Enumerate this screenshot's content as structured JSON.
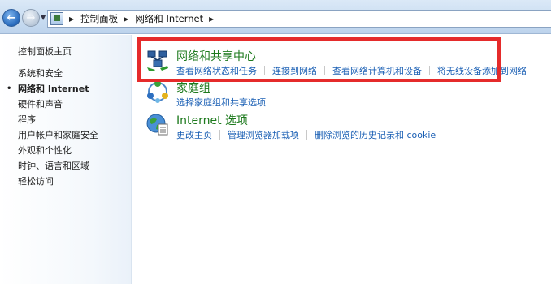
{
  "address_bar": {
    "crumbs": [
      "控制面板",
      "网络和 Internet"
    ]
  },
  "sidebar": {
    "home_label": "控制面板主页",
    "items": [
      {
        "label": "系统和安全"
      },
      {
        "label": "网络和 Internet",
        "active": true
      },
      {
        "label": "硬件和声音"
      },
      {
        "label": "程序"
      },
      {
        "label": "用户帐户和家庭安全"
      },
      {
        "label": "外观和个性化"
      },
      {
        "label": "时钟、语言和区域"
      },
      {
        "label": "轻松访问"
      }
    ],
    "active_bullet": "•"
  },
  "categories": [
    {
      "title": "网络和共享中心",
      "icon": "network-sharing-center-icon",
      "links": [
        "查看网络状态和任务",
        "连接到网络",
        "查看网络计算机和设备",
        "将无线设备添加到网络"
      ]
    },
    {
      "title": "家庭组",
      "icon": "homegroup-icon",
      "links": [
        "选择家庭组和共享选项"
      ]
    },
    {
      "title": "Internet 选项",
      "icon": "internet-options-icon",
      "links": [
        "更改主页",
        "管理浏览器加载项",
        "删除浏览的历史记录和 cookie"
      ]
    }
  ],
  "colors": {
    "category_title": "#1e7a1e",
    "link": "#1a5fb4",
    "highlight_border": "#e52b2b"
  }
}
